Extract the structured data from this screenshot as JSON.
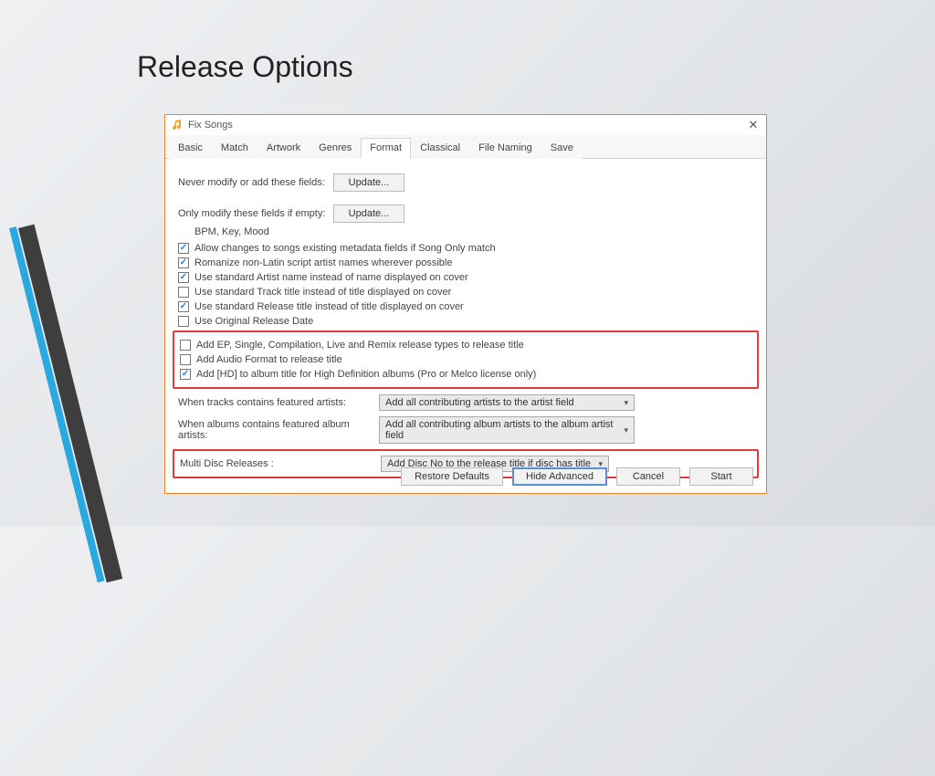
{
  "slide_title": "Release Options",
  "window": {
    "title": "Fix Songs",
    "close_glyph": "✕"
  },
  "tabs": [
    "Basic",
    "Match",
    "Artwork",
    "Genres",
    "Format",
    "Classical",
    "File Naming",
    "Save"
  ],
  "active_tab_index": 4,
  "rows": {
    "never_modify_label": "Never modify or add these fields:",
    "never_modify_button": "Update...",
    "only_modify_label": "Only modify these fields if empty:",
    "only_modify_button": "Update...",
    "only_modify_values": "BPM, Key, Mood"
  },
  "checkboxes": [
    {
      "checked": true,
      "label": "Allow changes to songs existing metadata fields if Song Only match"
    },
    {
      "checked": true,
      "label": "Romanize non-Latin script artist names wherever possible"
    },
    {
      "checked": true,
      "label": "Use standard Artist name instead of name displayed on cover"
    },
    {
      "checked": false,
      "label": "Use standard Track title instead of title displayed on cover"
    },
    {
      "checked": true,
      "label": "Use standard Release title instead of title displayed on cover"
    },
    {
      "checked": false,
      "label": "Use Original Release Date"
    }
  ],
  "hl_checks": [
    {
      "checked": false,
      "label": "Add EP, Single, Compilation, Live and Remix release types to release title"
    },
    {
      "checked": false,
      "label": "Add Audio Format to release title"
    },
    {
      "checked": true,
      "label": "Add [HD] to album title for High Definition albums (Pro or Melco license only)"
    }
  ],
  "selects": {
    "featured_artists_label": "When tracks contains featured artists:",
    "featured_artists_value": "Add all contributing artists to the artist field",
    "featured_album_label": "When albums contains featured album artists:",
    "featured_album_value": "Add all contributing album artists to the album artist field",
    "multi_disc_label": "Multi Disc Releases :",
    "multi_disc_value": "Add Disc No to the release title if disc has title"
  },
  "footer": {
    "restore": "Restore Defaults",
    "hide_adv": "Hide Advanced",
    "cancel": "Cancel",
    "start": "Start"
  }
}
